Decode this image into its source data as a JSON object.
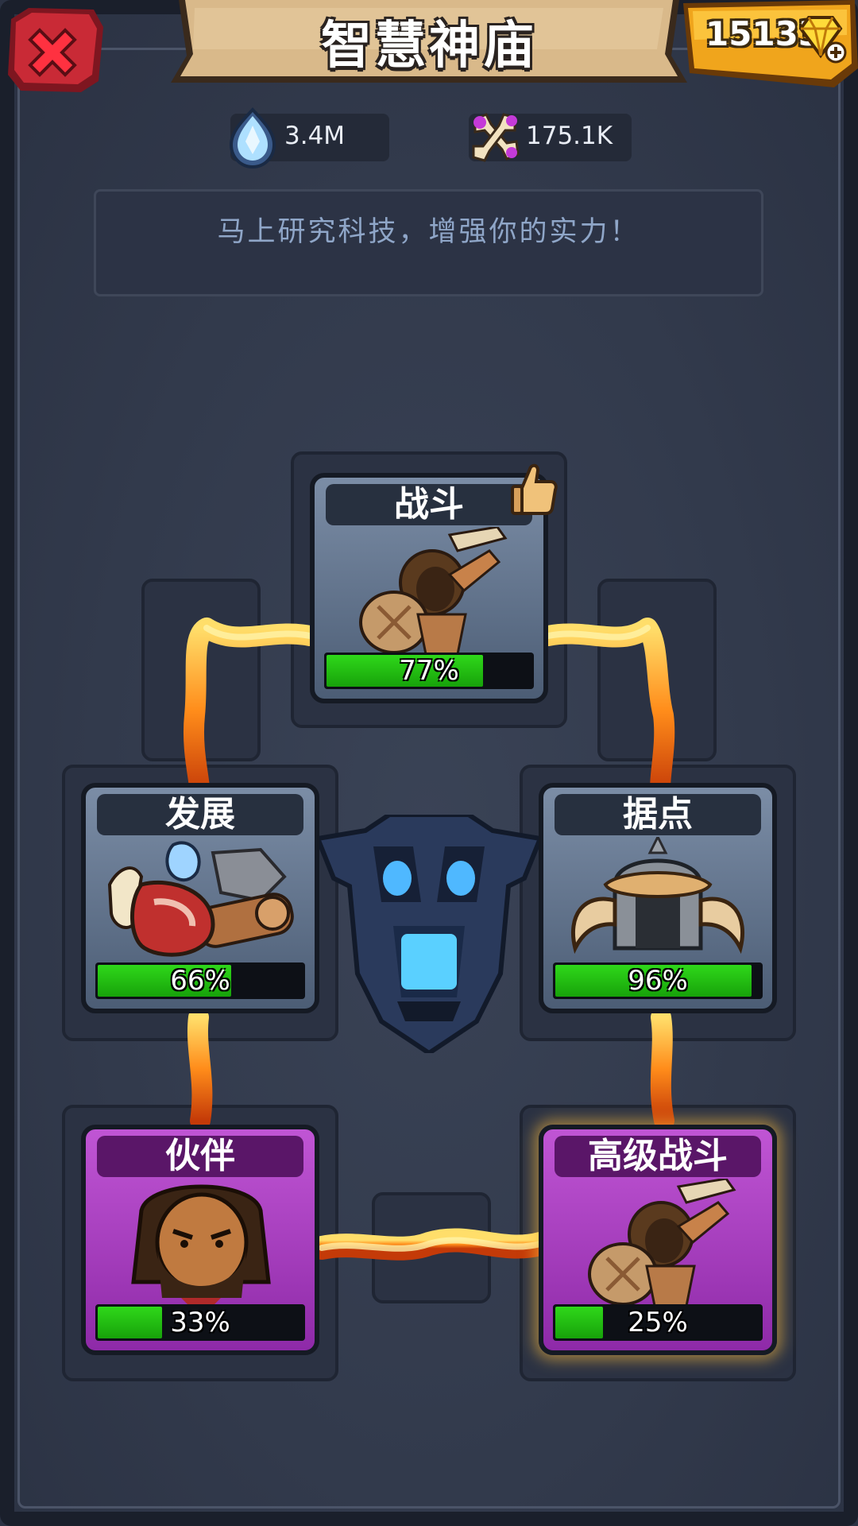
{
  "header": {
    "title": "智慧神庙",
    "gems": "15133",
    "close_icon": "close-x-icon",
    "gem_icon": "diamond-plus-icon"
  },
  "resources": {
    "crystal": "3.4M",
    "bone": "175.1K"
  },
  "info": {
    "text": "马上研究科技，增强你的实力！"
  },
  "tree": {
    "nodes": [
      {
        "label": "战斗",
        "percent": "77%",
        "progress": 0.77,
        "rarity": "gray",
        "icon": "caveman-warrior-icon"
      },
      {
        "label": "发展",
        "percent": "66%",
        "progress": 0.66,
        "rarity": "gray",
        "icon": "resources-meat-wood-icon"
      },
      {
        "label": "据点",
        "percent": "96%",
        "progress": 0.96,
        "rarity": "gray",
        "icon": "horned-helmet-icon"
      },
      {
        "label": "伙伴",
        "percent": "33%",
        "progress": 0.33,
        "rarity": "purple",
        "icon": "bearded-hero-portrait-icon"
      },
      {
        "label": "高级战斗",
        "percent": "25%",
        "progress": 0.25,
        "rarity": "purple",
        "icon": "caveman-warrior-icon"
      }
    ],
    "center_icon": "blue-skull-icon",
    "thumb_icon": "thumbs-up-icon"
  }
}
